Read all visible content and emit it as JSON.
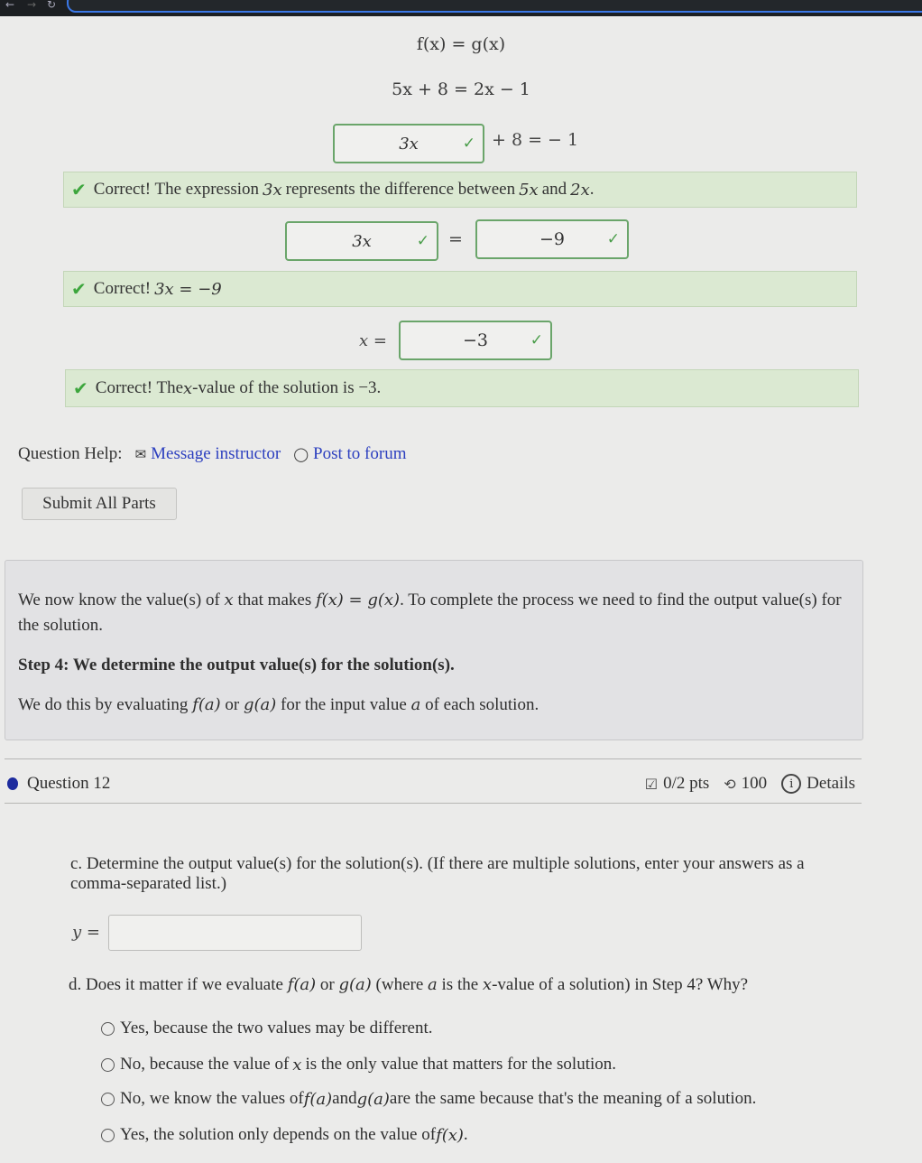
{
  "browser": {
    "back_icon": "arrow-left-icon",
    "forward_icon": "arrow-right-icon",
    "reload_icon": "reload-icon"
  },
  "work": {
    "eq1": "f(x) = g(x)",
    "eq2": "5x + 8 = 2x − 1",
    "step1": {
      "answer": "3x",
      "suffix": "+ 8 = − 1"
    },
    "feedback1": {
      "prefix": "Correct! The expression ",
      "math1": "3x",
      "mid": " represents the difference between ",
      "math2": "5x",
      "and": " and ",
      "math3": "2x",
      "end": "."
    },
    "step2": {
      "left_answer": "3x",
      "equals": "=",
      "right_answer": "−9"
    },
    "feedback2": {
      "prefix": "Correct! ",
      "math": "3x = −9"
    },
    "step3": {
      "label": "x =",
      "answer": "−3"
    },
    "feedback3": {
      "prefix": "Correct! The ",
      "math": "x",
      "rest": "-value of the solution is −3."
    }
  },
  "help": {
    "label": "Question Help:",
    "message_instructor": "Message instructor",
    "post_to_forum": "Post to forum"
  },
  "submit_all_label": "Submit All Parts",
  "info": {
    "p1_a": "We now know the value(s) of ",
    "p1_x": "x",
    "p1_b": " that makes ",
    "p1_eq": "f(x) = g(x)",
    "p1_c": ". To complete the process we need to find the output value(s) for the solution.",
    "step4": "Step 4: We determine the output value(s) for the solution(s).",
    "p3_a": "We do this by evaluating ",
    "p3_f": "f(a)",
    "p3_or": " or ",
    "p3_g": "g(a)",
    "p3_b": " for the input value ",
    "p3_a_var": "a",
    "p3_c": " of each solution."
  },
  "question": {
    "title": "Question 12",
    "points": "0/2 pts",
    "attempts": "100",
    "details": "Details"
  },
  "part_c": {
    "prompt": "c. Determine the output value(s) for the solution(s). (If there are multiple solutions, enter your answers as a comma-separated list.)",
    "y_label": "y =",
    "y_value": ""
  },
  "part_d": {
    "prompt_a": "d. Does it matter if we evaluate ",
    "prompt_f": "f(a)",
    "prompt_or": " or ",
    "prompt_g": "g(a)",
    "prompt_b": " (where ",
    "prompt_a_var": "a",
    "prompt_c": " is the ",
    "prompt_x": "x",
    "prompt_d": "-value of a solution) in Step 4? Why?",
    "options": [
      {
        "text": "Yes, because the two values may be different."
      },
      {
        "text_a": "No, because the value of ",
        "math": "x",
        "text_b": " is the only value that matters for the solution."
      },
      {
        "text_a": "No, we know the values of ",
        "math1": "f(a)",
        "and": " and ",
        "math2": "g(a)",
        "text_b": " are the same because that's the meaning of a solution."
      },
      {
        "text_a": "Yes, the solution only depends on the value of ",
        "math": "f(x)",
        "text_b": "."
      }
    ]
  }
}
